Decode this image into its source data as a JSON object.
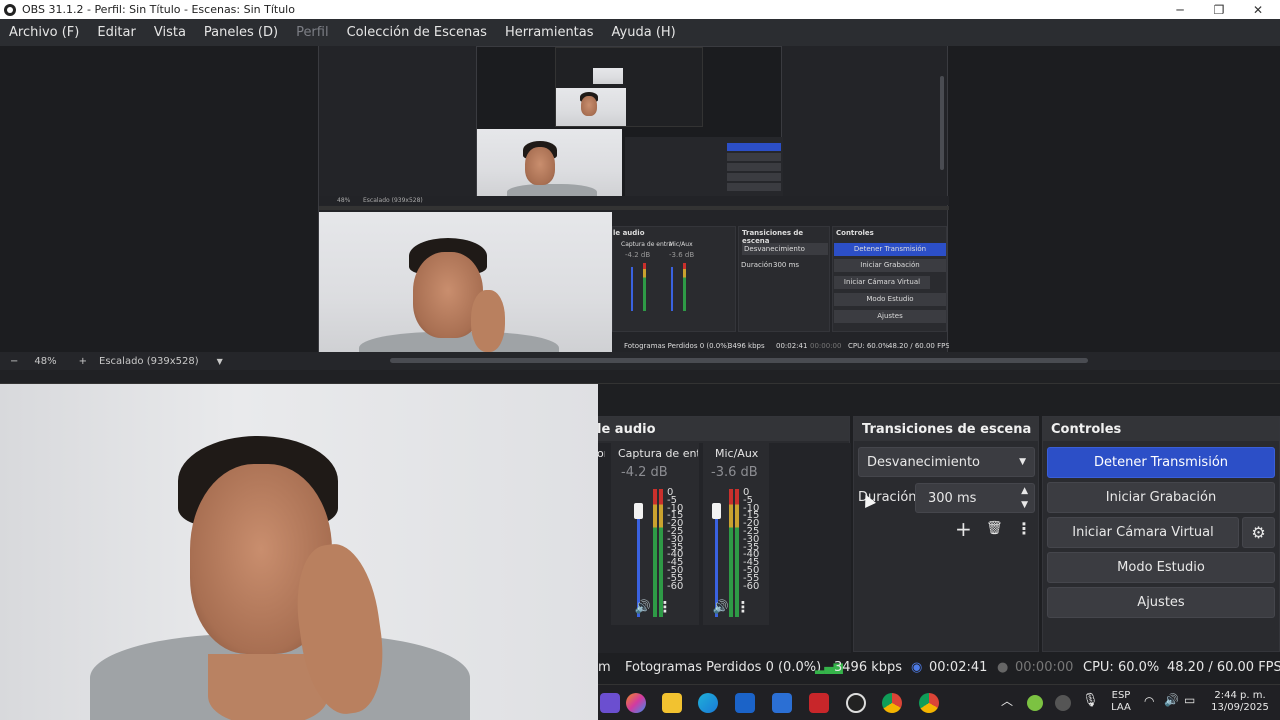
{
  "window": {
    "title": "OBS 31.1.2 - Perfil: Sin Título - Escenas: Sin Título",
    "minimize": "─",
    "maximize": "❐",
    "close": "✕"
  },
  "menu": [
    "Archivo (F)",
    "Editar",
    "Vista",
    "Paneles (D)",
    "Perfil",
    "Colección de Escenas",
    "Herramientas",
    "Ayuda (H)"
  ],
  "zoombar": {
    "minus": "−",
    "zoom": "48%",
    "plus": "+",
    "scale": "Escalado (939x528)",
    "dropdown": "▼"
  },
  "audio": {
    "title": "le audio",
    "partial_label": "or",
    "channels": [
      {
        "name": "Captura de entra",
        "db": "-4.2 dB"
      },
      {
        "name": "Mic/Aux",
        "db": "-3.6 dB"
      }
    ],
    "scale": [
      "0",
      "-5",
      "-10",
      "-15",
      "-20",
      "-25",
      "-30",
      "-35",
      "-40",
      "-45",
      "-50",
      "-55",
      "-60"
    ],
    "speaker_icon": "🔊",
    "menu_icon": "⋮"
  },
  "transitions": {
    "title": "Transiciones de escena",
    "selected": "Desvanecimiento",
    "duration_label": "Duración",
    "duration_value": "300 ms",
    "add": "+",
    "remove": "🗑",
    "more": "⋮"
  },
  "controls": {
    "title": "Controles",
    "stop_stream": "Detener Transmisión",
    "start_recording": "Iniciar Grabación",
    "virtual_cam": "Iniciar Cámara Virtual",
    "studio_mode": "Modo Estudio",
    "settings": "Ajustes",
    "gear": "⚙"
  },
  "status": {
    "partial": "m",
    "dropped": "Fotogramas Perdidos 0 (0.0%)",
    "bitrate": "3496 kbps",
    "stream_time": "00:02:41",
    "rec_time": "00:00:00",
    "cpu": "CPU: 60.0%",
    "fps": "48.20 / 60.00 FPS"
  },
  "nested_preview": {
    "zoom": "48%",
    "scale": "Escalado (939x528)",
    "audio_title": "le audio",
    "ch1": "Captura de entra",
    "ch1_db": "-4.2 dB",
    "ch2": "Mic/Aux",
    "ch2_db": "-3.6 dB",
    "transitions": "Transiciones de escena",
    "selected": "Desvanecimiento",
    "duration_label": "Duración",
    "duration_value": "300 ms",
    "controls": "Controles",
    "stop_stream": "Detener Transmisión",
    "start_recording": "Iniciar Grabación",
    "virtual_cam": "Iniciar Cámara Virtual",
    "studio_mode": "Modo Estudio",
    "settings": "Ajustes",
    "dropped": "Fotogramas Perdidos 0 (0.0%)",
    "bitrate": "3496 kbps",
    "stream_time": "00:02:41",
    "rec_time": "00:00:00",
    "cpu": "CPU: 60.0%",
    "fps": "48.20 / 60.00 FPS"
  },
  "taskbar": {
    "lang1": "ESP",
    "lang2": "LAA",
    "time": "2:44 p. m.",
    "date": "13/09/2025",
    "chevron": "︿"
  },
  "colors": {
    "accent": "#2c4fc7",
    "panel": "#2a2b2f",
    "background": "#1e1f22"
  }
}
